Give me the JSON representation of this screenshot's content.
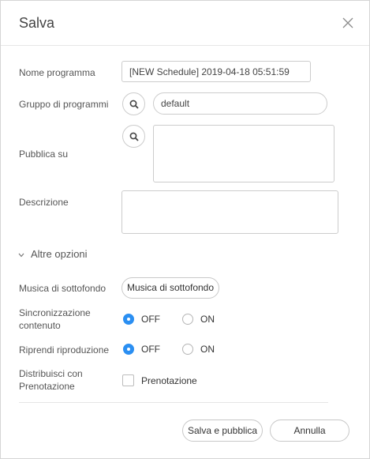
{
  "dialog": {
    "title": "Salva"
  },
  "fields": {
    "name": {
      "label": "Nome programma",
      "value": "[NEW Schedule] 2019-04-18 05:51:59"
    },
    "group": {
      "label": "Gruppo di programmi",
      "value": "default"
    },
    "publish": {
      "label": "Pubblica su",
      "value": ""
    },
    "description": {
      "label": "Descrizione",
      "value": ""
    }
  },
  "more_options": {
    "label": "Altre opzioni"
  },
  "options": {
    "music": {
      "label": "Musica di sottofondo",
      "button_label": "Musica di sottofondo"
    },
    "sync": {
      "label_line1": "Sincronizzazione",
      "label_line2": "contenuto",
      "off_label": "OFF",
      "on_label": "ON",
      "selected": "OFF"
    },
    "resume": {
      "label": "Riprendi riproduzione",
      "off_label": "OFF",
      "on_label": "ON",
      "selected": "OFF"
    },
    "distribute": {
      "label_line1": "Distribuisci con",
      "label_line2": "Prenotazione",
      "checkbox_label": "Prenotazione",
      "checked": false
    }
  },
  "footer": {
    "save_publish_label": "Salva e pubblica",
    "cancel_label": "Annulla"
  },
  "colors": {
    "accent": "#2b8ff2",
    "border": "#cccccc"
  }
}
